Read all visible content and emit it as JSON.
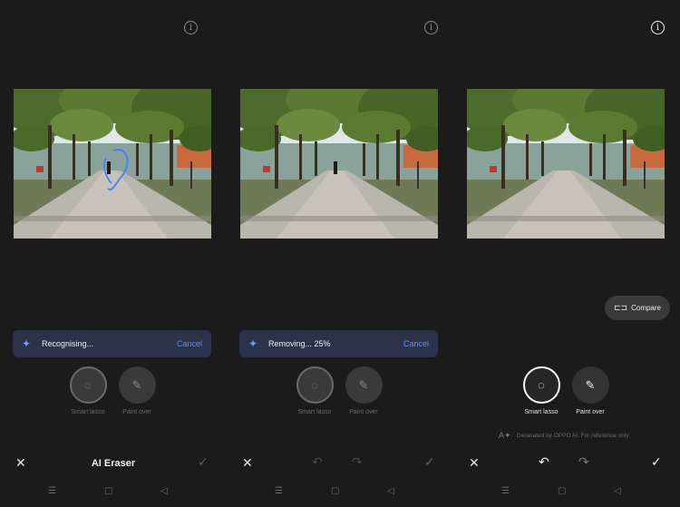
{
  "panels": [
    {
      "banner": {
        "status": "Recognising...",
        "cancel": "Cancel"
      },
      "tools": {
        "smart_lasso": "Smart lasso",
        "paint_over": "Paint over"
      },
      "bottom": {
        "title": "AI Eraser"
      }
    },
    {
      "banner": {
        "status": "Removing... 25%",
        "cancel": "Cancel"
      },
      "tools": {
        "smart_lasso": "Smart lasso",
        "paint_over": "Paint over"
      }
    },
    {
      "compare": "Compare",
      "tools": {
        "smart_lasso": "Smart lasso",
        "paint_over": "Paint over"
      },
      "disclaimer": "Generated by OPPO AI. For reference only."
    }
  ],
  "icons": {
    "info": "i",
    "sparkle": "✦",
    "close": "✕",
    "check": "✓",
    "undo": "↶",
    "redo": "↷",
    "lasso": "◌",
    "paint": "✎",
    "nav_menu": "☰",
    "nav_home": "▢",
    "nav_back": "◁"
  },
  "colors": {
    "background": "#1b1b1b",
    "banner_bg": "#2c3249",
    "accent_blue": "#5f8fff",
    "lasso_stroke": "#3c82ff"
  }
}
